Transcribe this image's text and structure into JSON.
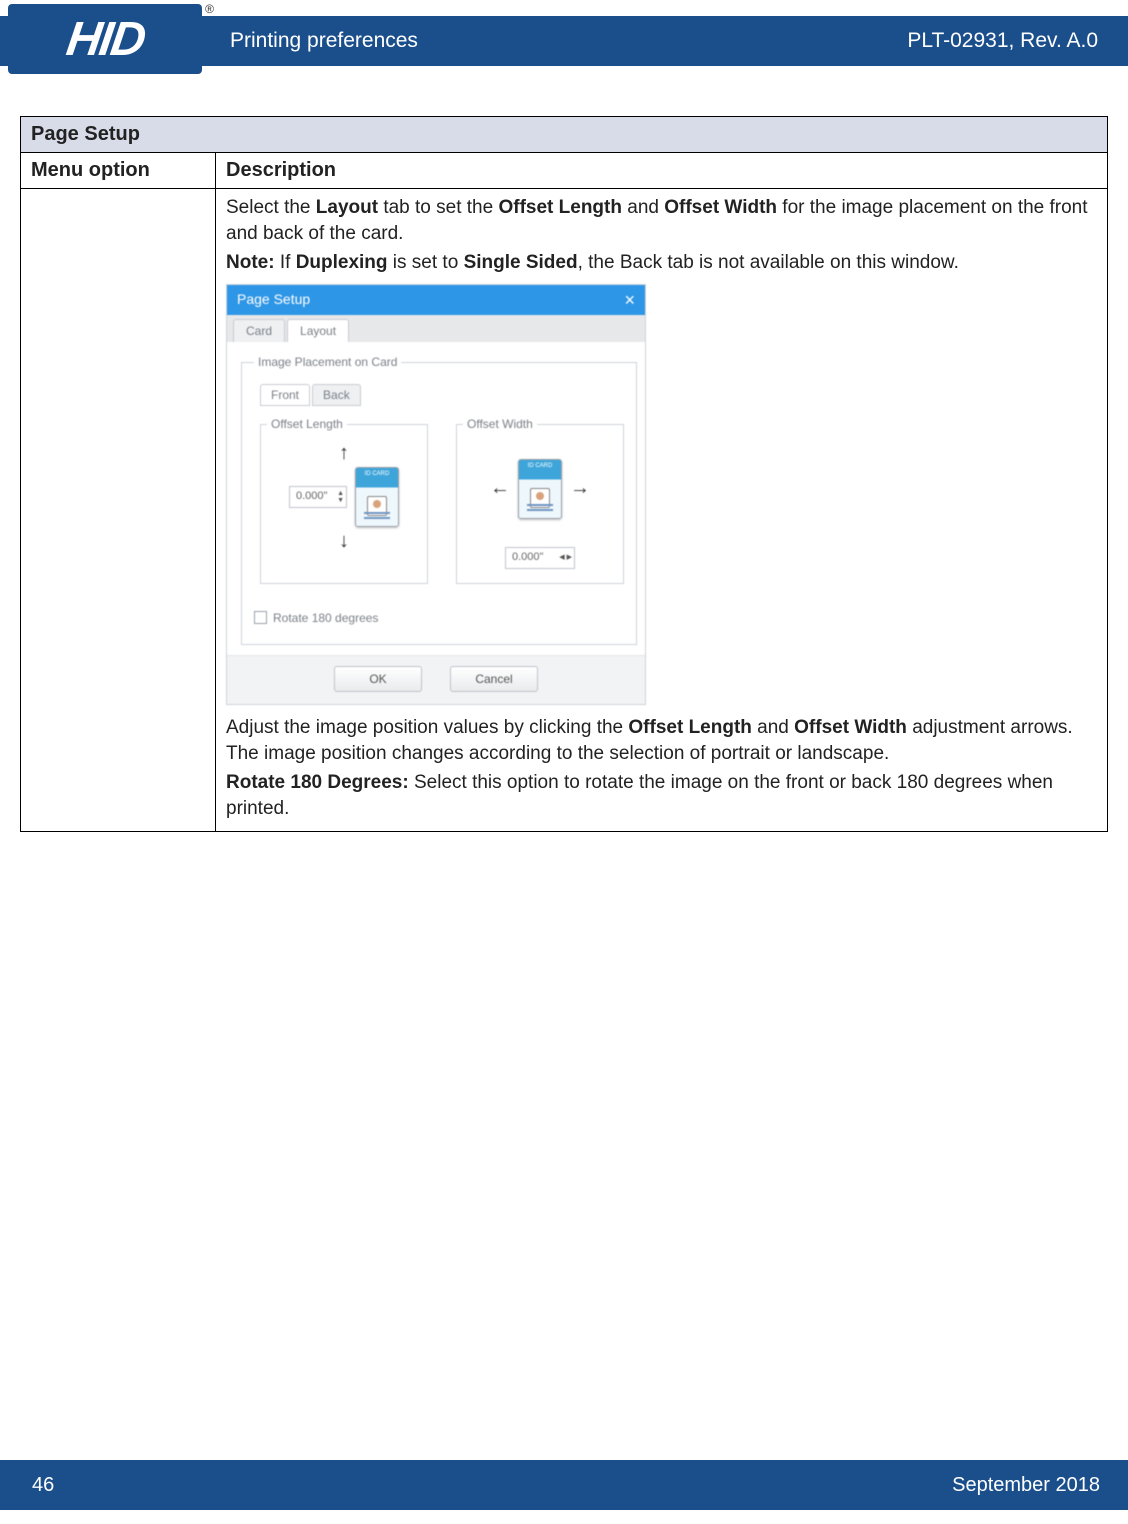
{
  "header": {
    "logo_text": "HID",
    "registered": "®",
    "section_title": "Printing preferences",
    "doc_rev": "PLT-02931, Rev. A.0"
  },
  "table": {
    "title": "Page Setup",
    "col_menu": "Menu option",
    "col_desc": "Description",
    "desc": {
      "p1_pre": "Select the ",
      "p1_b1": "Layout",
      "p1_mid1": " tab to set the ",
      "p1_b2": "Offset Length",
      "p1_mid2": " and ",
      "p1_b3": "Offset Width",
      "p1_post": " for the image placement on the front and back of the card.",
      "note_label": "Note:",
      "note_mid1": " If ",
      "note_b1": "Duplexing",
      "note_mid2": " is set to ",
      "note_b2": "Single Sided",
      "note_post": ", the Back tab is not available on this window.",
      "p2_pre": "Adjust the image position values by clicking the ",
      "p2_b1": "Offset Length",
      "p2_mid": " and ",
      "p2_b2": "Offset Width",
      "p2_post": " adjustment arrows. The image position changes according to the selection of portrait or landscape.",
      "p3_b": "Rotate 180 Degrees:",
      "p3_post": " Select this option to rotate the image on the front or back 180 degrees when printed."
    }
  },
  "dialog": {
    "title": "Page Setup",
    "close": "×",
    "tab_card": "Card",
    "tab_layout": "Layout",
    "group_label": "Image Placement on Card",
    "tab_front": "Front",
    "tab_back": "Back",
    "offset_length_label": "Offset Length",
    "offset_width_label": "Offset Width",
    "value_zero": "0.000\"",
    "rotate_label": "Rotate 180 degrees",
    "btn_ok": "OK",
    "btn_cancel": "Cancel",
    "arrow_up": "↑",
    "arrow_down": "↓",
    "arrow_left": "←",
    "arrow_right": "→",
    "spin_up": "▲",
    "spin_down": "▼",
    "spin_left": "◀",
    "spin_right": "▶"
  },
  "footer": {
    "page": "46",
    "date": "September 2018"
  }
}
